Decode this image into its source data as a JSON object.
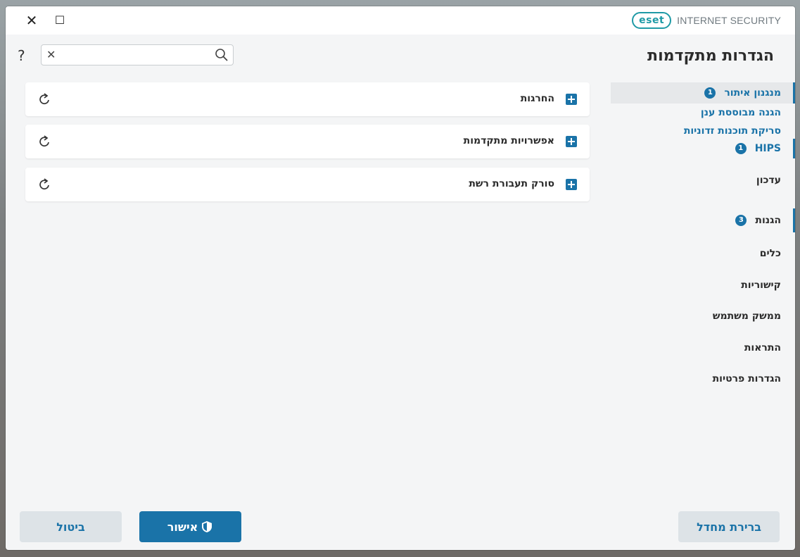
{
  "window": {
    "close_glyph": "✕",
    "maximize_glyph": "☐",
    "brand_logo": "eset",
    "product_name": "INTERNET SECURITY"
  },
  "header": {
    "help_glyph": "?",
    "search_placeholder": "",
    "title": "הגדרות מתקדמות"
  },
  "nav": {
    "items": [
      {
        "label": "מנגנון איתור",
        "badge": "1"
      },
      {
        "label": "הגנה מבוססת ענן"
      },
      {
        "label": "סריקת תוכנות זדוניות"
      },
      {
        "label": "HIPS",
        "badge": "1"
      },
      {
        "label": "עדכון"
      },
      {
        "label": "הגנות",
        "badge": "3"
      },
      {
        "label": "כלים"
      },
      {
        "label": "קישוריות"
      },
      {
        "label": "ממשק משתמש"
      },
      {
        "label": "התראות"
      },
      {
        "label": "הגדרות פרטיות"
      }
    ]
  },
  "sections": [
    {
      "label": "החרגות"
    },
    {
      "label": "אפשרויות מתקדמות"
    },
    {
      "label": "סורק תעבורת רשת"
    }
  ],
  "footer": {
    "default_label": "ברירת מחדל",
    "ok_label": "אישור",
    "cancel_label": "ביטול"
  },
  "colors": {
    "accent": "#1a73a8",
    "logo": "#1f9aa6",
    "background": "#f4f5f6"
  }
}
